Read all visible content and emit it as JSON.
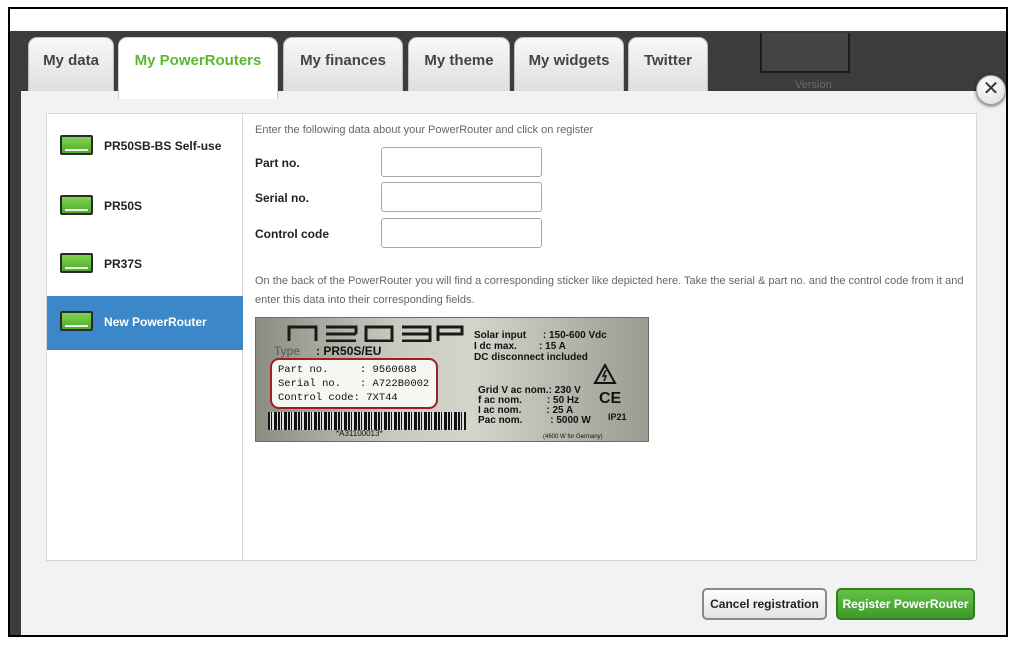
{
  "tabs": [
    {
      "label": "My data",
      "active": false
    },
    {
      "label": "My PowerRouters",
      "active": true
    },
    {
      "label": "My finances",
      "active": false
    },
    {
      "label": "My theme",
      "active": false
    },
    {
      "label": "My widgets",
      "active": false
    },
    {
      "label": "Twitter",
      "active": false
    }
  ],
  "background": {
    "partial_text": "Version"
  },
  "close": {
    "label": "✕",
    "icon": "close-icon"
  },
  "sidebar": {
    "items": [
      {
        "label": "PR50SB-BS Self-use",
        "icon": "power-router-icon",
        "active": false
      },
      {
        "label": "PR50S",
        "icon": "power-router-icon",
        "active": false
      },
      {
        "label": "PR37S",
        "icon": "power-router-icon",
        "active": false
      },
      {
        "label": "New PowerRouter",
        "icon": "power-router-icon",
        "active": true
      }
    ]
  },
  "form": {
    "intro": "Enter the following data about your PowerRouter and click on register",
    "fields": [
      {
        "label": "Part no.",
        "value": ""
      },
      {
        "label": "Serial no.",
        "value": ""
      },
      {
        "label": "Control code",
        "value": ""
      }
    ],
    "note": "On the back of the PowerRouter you will find a corresponding sticker like depicted here. Take the serial & part no. and the control code from it and enter this data into their corresponding fields."
  },
  "sticker": {
    "type_label": "Type",
    "type_value": ": PR50S/EU",
    "part_line": "Part no.     : 9560688",
    "serial_line": "Serial no.   : A722B0002",
    "control_line": "Control code: 7XT44",
    "barcode_text": "*A31100013*",
    "specs_top": [
      "Solar input      : 150-600 Vdc",
      "I dc max.        : 15 A",
      "DC disconnect included"
    ],
    "specs_bottom": [
      "Grid V ac nom.: 230 V",
      "f ac nom.         : 50 Hz",
      "I ac nom.         : 25 A",
      "Pac nom.          : 5000 W"
    ],
    "ce": "CE",
    "ip": "IP21",
    "germany_note": "(4600 W for Germany)"
  },
  "buttons": {
    "cancel": "Cancel registration",
    "register": "Register PowerRouter"
  },
  "colors": {
    "active_tab_text": "#5ab82e",
    "sidebar_active": "#3c87c7",
    "register_button": "#4aa935",
    "code_box_border": "#9b1f25"
  }
}
